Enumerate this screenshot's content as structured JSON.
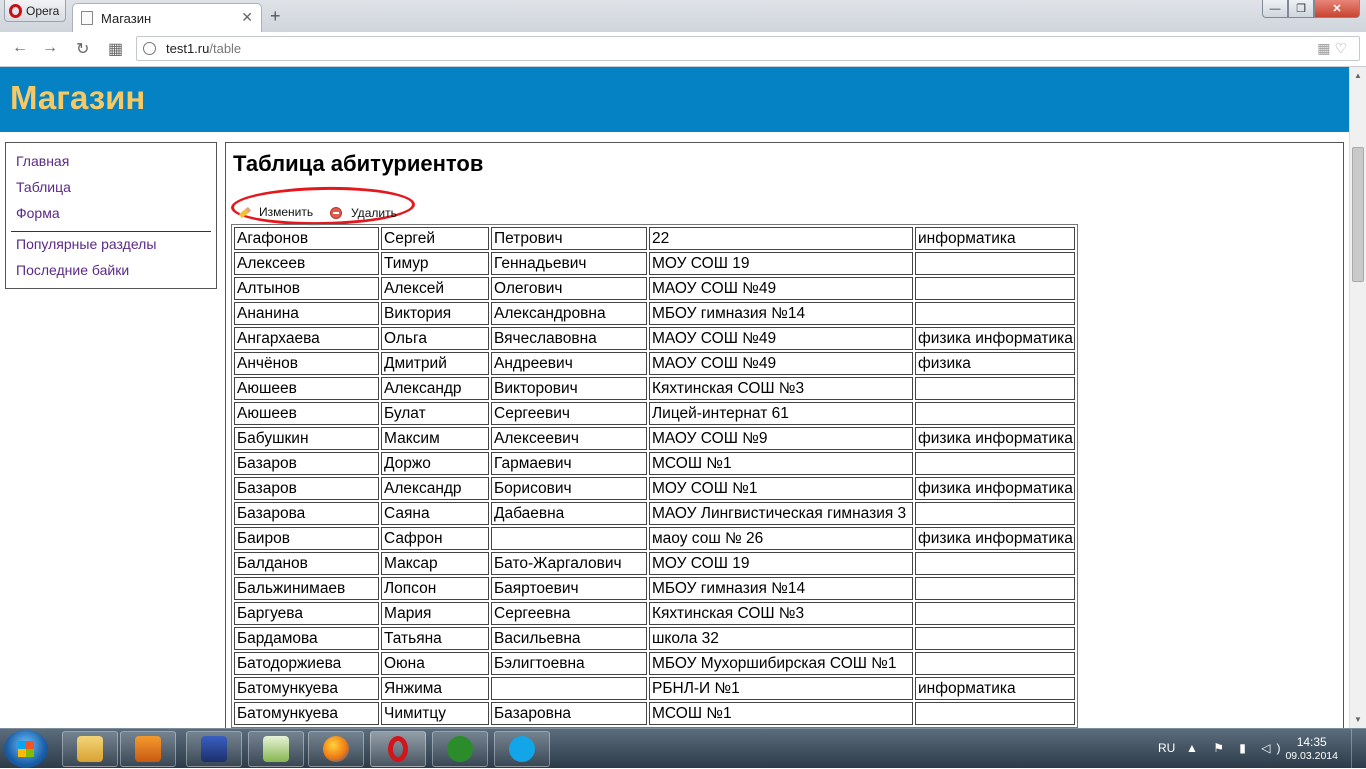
{
  "browser": {
    "menu_label": "Opera",
    "tab_title": "Магазин",
    "url_host": "test1.ru",
    "url_path": "/table"
  },
  "site": {
    "title": "Магазин",
    "nav": [
      "Главная",
      "Таблица",
      "Форма"
    ],
    "nav_secondary": [
      "Популярные разделы",
      "Последние байки"
    ]
  },
  "page": {
    "heading": "Таблица абитуриентов",
    "edit_label": "Изменить",
    "delete_label": "Удалить"
  },
  "table": {
    "rows": [
      [
        "Агафонов",
        "Сергей",
        "Петрович",
        "22",
        "информатика"
      ],
      [
        "Алексеев",
        "Тимур",
        "Геннадьевич",
        "МОУ СОШ 19",
        ""
      ],
      [
        "Алтынов",
        "Алексей",
        "Олегович",
        "МАОУ СОШ №49",
        ""
      ],
      [
        "Ананина",
        "Виктория",
        "Александровна",
        "МБОУ гимназия №14",
        ""
      ],
      [
        "Ангархаева",
        "Ольга",
        "Вячеславовна",
        "МАОУ СОШ №49",
        "физика информатика"
      ],
      [
        "Анчёнов",
        "Дмитрий",
        "Андреевич",
        "МАОУ СОШ №49",
        "физика"
      ],
      [
        "Аюшеев",
        "Александр",
        "Викторович",
        "Кяхтинская СОШ №3",
        ""
      ],
      [
        "Аюшеев",
        "Булат",
        "Сергеевич",
        "Лицей-интернат 61",
        ""
      ],
      [
        "Бабушкин",
        "Максим",
        "Алексеевич",
        "МАОУ СОШ №9",
        "физика информатика"
      ],
      [
        "Базаров",
        "Доржо",
        "Гармаевич",
        "МСОШ №1",
        ""
      ],
      [
        "Базаров",
        "Александр",
        "Борисович",
        "МОУ СОШ №1",
        "физика информатика"
      ],
      [
        "Базарова",
        "Саяна",
        "Дабаевна",
        "МАОУ Лингвистическая гимназия  3",
        ""
      ],
      [
        "Баиров",
        "Сафрон",
        "",
        "маоу сош № 26",
        "физика информатика"
      ],
      [
        "Балданов",
        "Максар",
        "Бато-Жаргалович",
        "МОУ СОШ 19",
        ""
      ],
      [
        "Бальжинимаев",
        "Лопсон",
        "Баяртоевич",
        "МБОУ гимназия №14",
        ""
      ],
      [
        "Баргуева",
        "Мария",
        "Сергеевна",
        "Кяхтинская СОШ №3",
        ""
      ],
      [
        "Бардамова",
        "Татьяна",
        "Васильевна",
        "школа 32",
        ""
      ],
      [
        "Батодоржиева",
        "Оюна",
        "Бэлигтоевна",
        "МБОУ Мухоршибирская СОШ №1",
        ""
      ],
      [
        "Батомункуева",
        "Янжима",
        "",
        "РБНЛ-И №1",
        "информатика"
      ],
      [
        "Батомункуева",
        "Чимитцу",
        "Базаровна",
        "МСОШ №1",
        ""
      ]
    ]
  },
  "taskbar": {
    "language": "RU",
    "time": "14:35",
    "date": "09.03.2014"
  }
}
